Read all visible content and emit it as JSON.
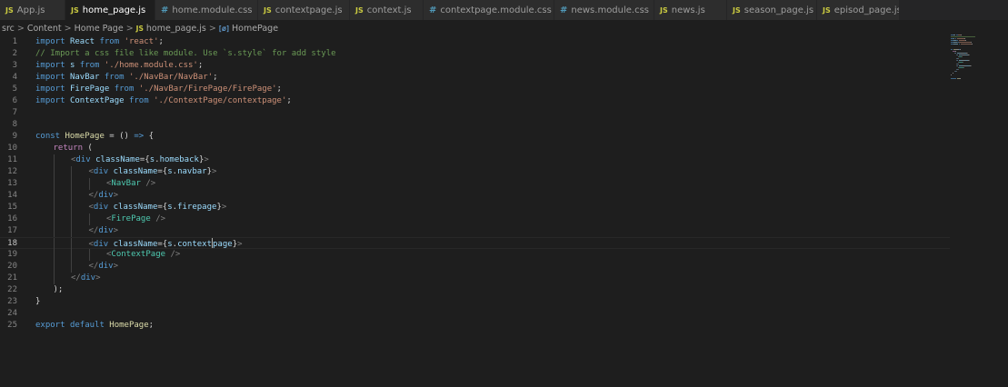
{
  "tabs": [
    {
      "type": "js",
      "icon": "JS",
      "label": "App.js",
      "active": false
    },
    {
      "type": "js",
      "icon": "JS",
      "label": "home_page.js",
      "active": true,
      "close": "×"
    },
    {
      "type": "css",
      "icon": "#",
      "label": "home.module.css",
      "active": false
    },
    {
      "type": "js",
      "icon": "JS",
      "label": "contextpage.js",
      "active": false
    },
    {
      "type": "js",
      "icon": "JS",
      "label": "context.js",
      "active": false
    },
    {
      "type": "css",
      "icon": "#",
      "label": "contextpage.module.css",
      "active": false
    },
    {
      "type": "css",
      "icon": "#",
      "label": "news.module.css",
      "active": false
    },
    {
      "type": "js",
      "icon": "JS",
      "label": "news.js",
      "active": false
    },
    {
      "type": "js",
      "icon": "JS",
      "label": "season_page.js",
      "active": false
    },
    {
      "type": "js",
      "icon": "JS",
      "label": "episod_page.js",
      "active": false
    }
  ],
  "breadcrumb": {
    "items": [
      "src",
      "Content",
      "Home Page"
    ],
    "file_icon": "JS",
    "file": "home_page.js",
    "symbol_icon": "[ø]",
    "symbol": "HomePage",
    "separator": ">"
  },
  "editor": {
    "current_line": 18,
    "lines": [
      {
        "n": "1",
        "indent": 0,
        "tokens": [
          [
            "kw",
            "import"
          ],
          [
            "pl",
            " "
          ],
          [
            "var",
            "React"
          ],
          [
            "pl",
            " "
          ],
          [
            "kw",
            "from"
          ],
          [
            "pl",
            " "
          ],
          [
            "str",
            "'react'"
          ],
          [
            "pl",
            ";"
          ]
        ]
      },
      {
        "n": "2",
        "indent": 0,
        "tokens": [
          [
            "cmt",
            "// Import a css file like module. Use `s.style` for add style"
          ]
        ]
      },
      {
        "n": "3",
        "indent": 0,
        "tokens": [
          [
            "kw",
            "import"
          ],
          [
            "pl",
            " "
          ],
          [
            "var",
            "s"
          ],
          [
            "pl",
            " "
          ],
          [
            "kw",
            "from"
          ],
          [
            "pl",
            " "
          ],
          [
            "str",
            "'./home.module.css'"
          ],
          [
            "pl",
            ";"
          ]
        ]
      },
      {
        "n": "4",
        "indent": 0,
        "tokens": [
          [
            "kw",
            "import"
          ],
          [
            "pl",
            " "
          ],
          [
            "var",
            "NavBar"
          ],
          [
            "pl",
            " "
          ],
          [
            "kw",
            "from"
          ],
          [
            "pl",
            " "
          ],
          [
            "str",
            "'./NavBar/NavBar'"
          ],
          [
            "pl",
            ";"
          ]
        ]
      },
      {
        "n": "5",
        "indent": 0,
        "tokens": [
          [
            "kw",
            "import"
          ],
          [
            "pl",
            " "
          ],
          [
            "var",
            "FirePage"
          ],
          [
            "pl",
            " "
          ],
          [
            "kw",
            "from"
          ],
          [
            "pl",
            " "
          ],
          [
            "str",
            "'./NavBar/FirePage/FirePage'"
          ],
          [
            "pl",
            ";"
          ]
        ]
      },
      {
        "n": "6",
        "indent": 0,
        "tokens": [
          [
            "kw",
            "import"
          ],
          [
            "pl",
            " "
          ],
          [
            "var",
            "ContextPage"
          ],
          [
            "pl",
            " "
          ],
          [
            "kw",
            "from"
          ],
          [
            "pl",
            " "
          ],
          [
            "str",
            "'./ContextPage/contextpage'"
          ],
          [
            "pl",
            ";"
          ]
        ]
      },
      {
        "n": "7",
        "indent": 0,
        "tokens": []
      },
      {
        "n": "8",
        "indent": 0,
        "tokens": []
      },
      {
        "n": "9",
        "indent": 0,
        "tokens": [
          [
            "kw",
            "const"
          ],
          [
            "pl",
            " "
          ],
          [
            "fn",
            "HomePage"
          ],
          [
            "pl",
            " = () "
          ],
          [
            "kw",
            "=>"
          ],
          [
            "pl",
            " {"
          ]
        ]
      },
      {
        "n": "10",
        "indent": 1,
        "tokens": [
          [
            "ctl",
            "return"
          ],
          [
            "pl",
            " ("
          ]
        ]
      },
      {
        "n": "11",
        "indent": 2,
        "tokens": [
          [
            "tag",
            "<"
          ],
          [
            "el",
            "div"
          ],
          [
            "pl",
            " "
          ],
          [
            "attr",
            "className"
          ],
          [
            "pl",
            "={"
          ],
          [
            "var",
            "s"
          ],
          [
            "pl",
            "."
          ],
          [
            "var",
            "homeback"
          ],
          [
            "pl",
            "}"
          ],
          [
            "tag",
            ">"
          ]
        ]
      },
      {
        "n": "12",
        "indent": 3,
        "tokens": [
          [
            "tag",
            "<"
          ],
          [
            "el",
            "div"
          ],
          [
            "pl",
            " "
          ],
          [
            "attr",
            "className"
          ],
          [
            "pl",
            "={"
          ],
          [
            "var",
            "s"
          ],
          [
            "pl",
            "."
          ],
          [
            "var",
            "navbar"
          ],
          [
            "pl",
            "}"
          ],
          [
            "tag",
            ">"
          ]
        ]
      },
      {
        "n": "13",
        "indent": 4,
        "tokens": [
          [
            "tag",
            "<"
          ],
          [
            "cls",
            "NavBar"
          ],
          [
            "pl",
            " "
          ],
          [
            "tag",
            "/>"
          ]
        ]
      },
      {
        "n": "14",
        "indent": 3,
        "tokens": [
          [
            "tag",
            "</"
          ],
          [
            "el",
            "div"
          ],
          [
            "tag",
            ">"
          ]
        ]
      },
      {
        "n": "15",
        "indent": 3,
        "tokens": [
          [
            "tag",
            "<"
          ],
          [
            "el",
            "div"
          ],
          [
            "pl",
            " "
          ],
          [
            "attr",
            "className"
          ],
          [
            "pl",
            "={"
          ],
          [
            "var",
            "s"
          ],
          [
            "pl",
            "."
          ],
          [
            "var",
            "firepage"
          ],
          [
            "pl",
            "}"
          ],
          [
            "tag",
            ">"
          ]
        ]
      },
      {
        "n": "16",
        "indent": 4,
        "tokens": [
          [
            "tag",
            "<"
          ],
          [
            "cls",
            "FirePage"
          ],
          [
            "pl",
            " "
          ],
          [
            "tag",
            "/>"
          ]
        ]
      },
      {
        "n": "17",
        "indent": 3,
        "tokens": [
          [
            "tag",
            "</"
          ],
          [
            "el",
            "div"
          ],
          [
            "tag",
            ">"
          ]
        ]
      },
      {
        "n": "18",
        "indent": 3,
        "tokens": [
          [
            "tag",
            "<"
          ],
          [
            "el",
            "div"
          ],
          [
            "pl",
            " "
          ],
          [
            "attr",
            "className"
          ],
          [
            "pl",
            "={"
          ],
          [
            "var",
            "s"
          ],
          [
            "pl",
            "."
          ],
          [
            "var",
            "context"
          ],
          [
            "cursor",
            ""
          ],
          [
            "var",
            "page"
          ],
          [
            "pl",
            "}"
          ],
          [
            "tag",
            ">"
          ]
        ]
      },
      {
        "n": "19",
        "indent": 4,
        "tokens": [
          [
            "tag",
            "<"
          ],
          [
            "cls",
            "ContextPage"
          ],
          [
            "pl",
            " "
          ],
          [
            "tag",
            "/>"
          ]
        ]
      },
      {
        "n": "20",
        "indent": 3,
        "tokens": [
          [
            "tag",
            "</"
          ],
          [
            "el",
            "div"
          ],
          [
            "tag",
            ">"
          ]
        ]
      },
      {
        "n": "21",
        "indent": 2,
        "tokens": [
          [
            "tag",
            "</"
          ],
          [
            "el",
            "div"
          ],
          [
            "tag",
            ">"
          ]
        ]
      },
      {
        "n": "22",
        "indent": 1,
        "tokens": [
          [
            "pl",
            ");"
          ]
        ]
      },
      {
        "n": "23",
        "indent": 0,
        "tokens": [
          [
            "pl",
            "}"
          ]
        ]
      },
      {
        "n": "24",
        "indent": 0,
        "tokens": []
      },
      {
        "n": "25",
        "indent": 0,
        "tokens": [
          [
            "kw",
            "export"
          ],
          [
            "pl",
            " "
          ],
          [
            "kw",
            "default"
          ],
          [
            "pl",
            " "
          ],
          [
            "fn",
            "HomePage"
          ],
          [
            "pl",
            ";"
          ]
        ]
      }
    ]
  },
  "colors": {
    "background": "#1e1e1e",
    "tabbar": "#252526",
    "tab": "#2d2d2d",
    "js_icon": "#cbcb41",
    "css_icon": "#519aba"
  }
}
